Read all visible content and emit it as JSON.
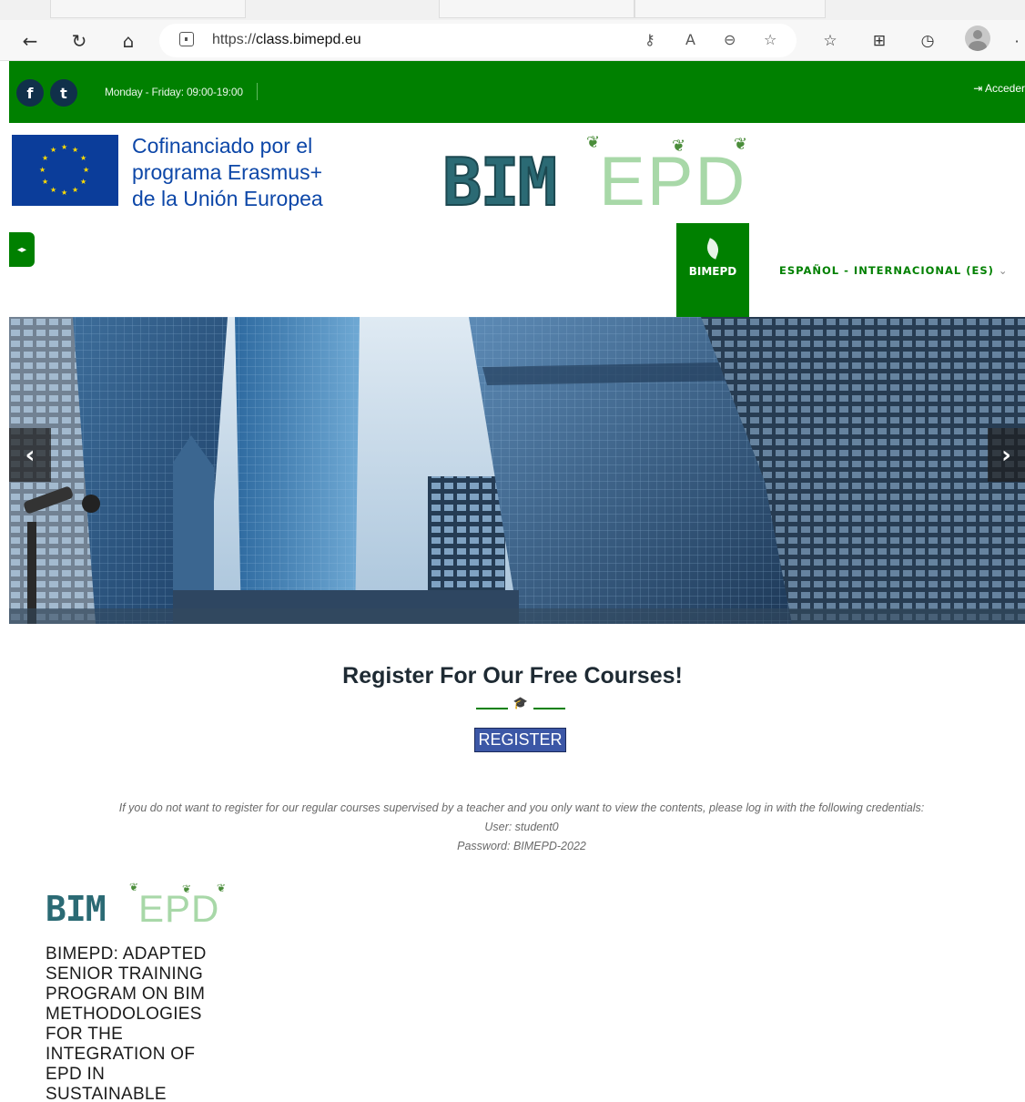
{
  "browser": {
    "url_prefix": "https://",
    "url_host": "class.bimepd.eu",
    "icons": [
      "back-icon",
      "reload-icon",
      "home-icon",
      "lock-icon",
      "key-icon",
      "read-aloud-icon",
      "zoom-out-icon",
      "add-favorite-icon",
      "favorites-icon",
      "collections-icon",
      "history-icon",
      "profile-icon",
      "more-icon"
    ]
  },
  "topbar": {
    "hours": "Monday - Friday: 09:00-19:00",
    "login": "Acceder",
    "facebook_glyph": "f",
    "twitter_glyph": "t"
  },
  "header": {
    "eu_text": [
      "Cofinanciado por el",
      "programa Erasmus+",
      "de la Unión Europea"
    ],
    "logo_bim": "BIM",
    "logo_epd": "EPD"
  },
  "nav": {
    "brand_label": "BIMEPD",
    "language": "ESPAÑOL - INTERNACIONAL (ES)",
    "language_chevron": "⌄"
  },
  "hero": {
    "prev": "‹",
    "next": "›"
  },
  "register": {
    "title": "Register For Our Free Courses!",
    "button": "REGISTER",
    "info_line1": "If you do not want to register for our regular courses supervised by a teacher and you only want to view the contents, please log in with the following credentials:",
    "info_line2": "User: student0",
    "info_line3": "Password: BIMEPD-2022"
  },
  "footer": {
    "logo_bim": "BIM",
    "logo_epd": "EPD",
    "program_title": "BIMEPD: ADAPTED SENIOR TRAINING PROGRAM ON BIM METHODOLOGIES FOR THE INTEGRATION OF EPD IN SUSTAINABLE"
  },
  "colors": {
    "brand_green": "#008000",
    "eu_blue": "#0d47a8",
    "register_button": "#3c57a6"
  }
}
